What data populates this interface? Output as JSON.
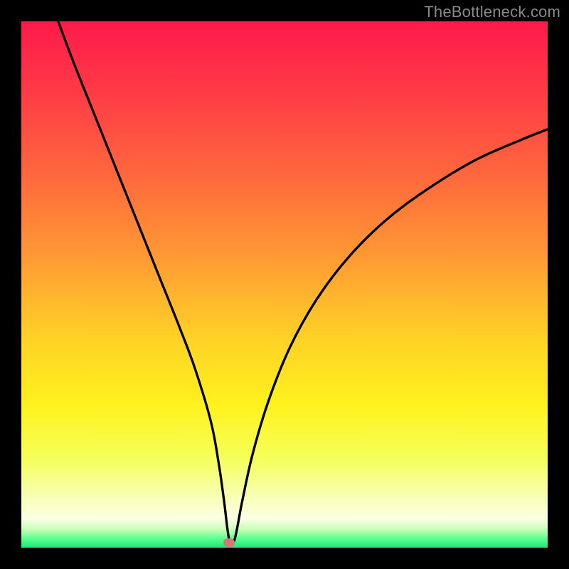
{
  "watermark": "TheBottleneck.com",
  "gradient_stops": [
    {
      "offset": 0,
      "color": "#ff1a4a"
    },
    {
      "offset": 0.14,
      "color": "#ff3c46"
    },
    {
      "offset": 0.3,
      "color": "#ff6a3c"
    },
    {
      "offset": 0.45,
      "color": "#ff9a33"
    },
    {
      "offset": 0.6,
      "color": "#ffd126"
    },
    {
      "offset": 0.73,
      "color": "#fff21e"
    },
    {
      "offset": 0.83,
      "color": "#f5ff5a"
    },
    {
      "offset": 0.9,
      "color": "#f7ffb0"
    },
    {
      "offset": 0.945,
      "color": "#fcffe4"
    },
    {
      "offset": 0.965,
      "color": "#c8ffb8"
    },
    {
      "offset": 0.985,
      "color": "#4fff8a"
    },
    {
      "offset": 1.0,
      "color": "#1fe47a"
    }
  ],
  "chart_data": {
    "type": "line",
    "title": "",
    "xlabel": "",
    "ylabel": "",
    "xlim": [
      0,
      100
    ],
    "ylim": [
      0,
      100
    ],
    "grid": false,
    "marker": {
      "x": 39.5,
      "y": 1,
      "color": "#cf7a78"
    },
    "series": [
      {
        "name": "curve",
        "x": [
          7,
          10,
          14,
          18,
          22,
          26,
          30,
          33,
          36,
          37.5,
          38.5,
          39.5,
          40.5,
          42,
          44,
          47,
          51,
          56,
          62,
          69,
          77,
          86,
          95,
          100
        ],
        "values": [
          100,
          92,
          82,
          72,
          62,
          52,
          42,
          34,
          24,
          16,
          9,
          1.5,
          1.5,
          9,
          18,
          28,
          38,
          47,
          55,
          62,
          68,
          73.5,
          77.5,
          79.5
        ]
      }
    ]
  }
}
